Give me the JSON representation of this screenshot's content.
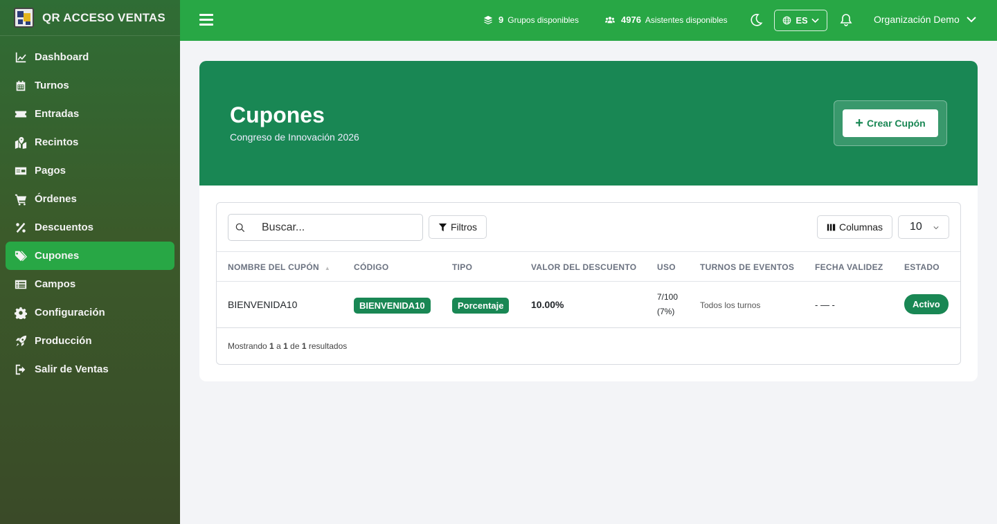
{
  "brand": {
    "title": "QR ACCESO VENTAS"
  },
  "sidebar": {
    "items": [
      {
        "label": "Dashboard",
        "icon": "chart-line-icon",
        "active": false
      },
      {
        "label": "Turnos",
        "icon": "calendar-icon",
        "active": false
      },
      {
        "label": "Entradas",
        "icon": "ticket-icon",
        "active": false
      },
      {
        "label": "Recintos",
        "icon": "map-marked-icon",
        "active": false
      },
      {
        "label": "Pagos",
        "icon": "money-check-icon",
        "active": false
      },
      {
        "label": "Órdenes",
        "icon": "cart-icon",
        "active": false
      },
      {
        "label": "Descuentos",
        "icon": "percent-icon",
        "active": false
      },
      {
        "label": "Cupones",
        "icon": "tags-icon",
        "active": true
      },
      {
        "label": "Campos",
        "icon": "list-icon",
        "active": false
      },
      {
        "label": "Configuración",
        "icon": "gear-icon",
        "active": false
      },
      {
        "label": "Producción",
        "icon": "rocket-icon",
        "active": false
      },
      {
        "label": "Salir de Ventas",
        "icon": "sign-out-icon",
        "active": false
      }
    ]
  },
  "topbar": {
    "groups_count": "9",
    "groups_label": "Grupos disponibles",
    "attendees_count": "4976",
    "attendees_label": "Asistentes disponibles",
    "language": "ES",
    "organization": "Organización Demo"
  },
  "hero": {
    "title": "Cupones",
    "subtitle": "Congreso de Innovación 2026",
    "create_button": "Crear Cupón"
  },
  "table": {
    "search_placeholder": "Buscar...",
    "filters_label": "Filtros",
    "columns_label": "Columnas",
    "per_page": "10",
    "columns": [
      "NOMBRE DEL CUPÓN",
      "CÓDIGO",
      "TIPO",
      "VALOR DEL DESCUENTO",
      "USO",
      "TURNOS DE EVENTOS",
      "FECHA VALIDEZ",
      "ESTADO"
    ],
    "rows": [
      {
        "name": "BIENVENIDA10",
        "code": "BIENVENIDA10",
        "type": "Porcentaje",
        "value": "10.00%",
        "usage_count": "7/100",
        "usage_pct": "(7%)",
        "shifts": "Todos los turnos",
        "validity": "- — -",
        "status": "Activo"
      }
    ],
    "footer": {
      "prefix": "Mostrando",
      "from": "1",
      "sep1": "a",
      "to": "1",
      "sep2": "de",
      "total": "1",
      "suffix": "resultados"
    }
  },
  "colors": {
    "primary": "#28a745",
    "hero": "#198754",
    "badge": "#198754"
  }
}
